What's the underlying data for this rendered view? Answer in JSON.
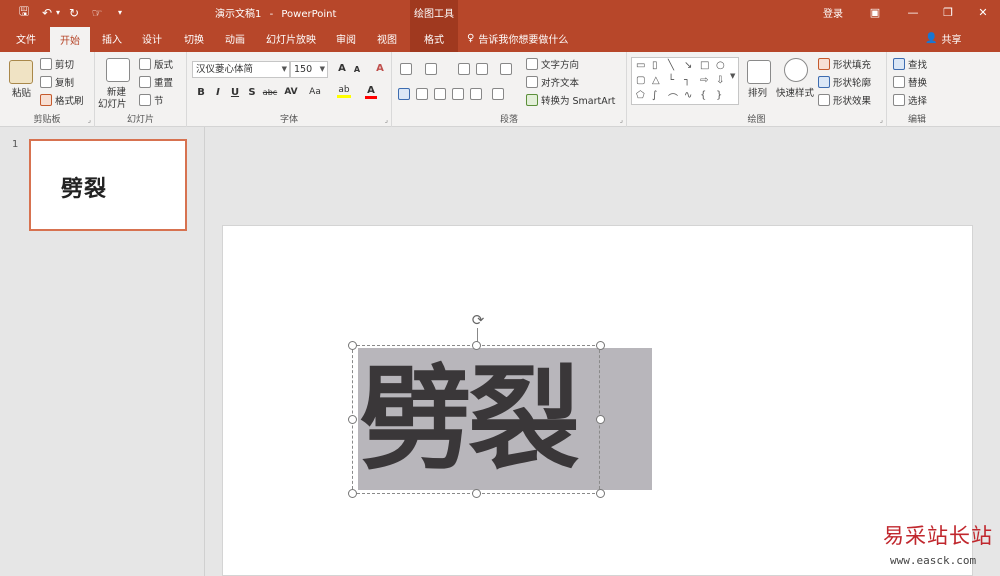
{
  "titlebar": {
    "document_name": "演示文稿1",
    "separator": "-",
    "app_name": "PowerPoint",
    "context_tools": "绘图工具",
    "login": "登录",
    "quick_access": {
      "save": "🖫",
      "undo": "↶",
      "undo_arrow": "▾",
      "redo": "↻",
      "touch": "☞",
      "customize": "▾"
    },
    "window": {
      "ribbon_options": "▣",
      "minimize": "—",
      "restore": "❐",
      "close": "✕"
    }
  },
  "tabs": [
    {
      "label": "文件"
    },
    {
      "label": "开始"
    },
    {
      "label": "插入"
    },
    {
      "label": "设计"
    },
    {
      "label": "切换"
    },
    {
      "label": "动画"
    },
    {
      "label": "幻灯片放映"
    },
    {
      "label": "审阅"
    },
    {
      "label": "视图"
    },
    {
      "label": "格式"
    }
  ],
  "tell_me": {
    "icon": "♀",
    "text": "告诉我你想要做什么"
  },
  "share": {
    "icon": "👤",
    "text": "共享"
  },
  "ribbon": {
    "clipboard": {
      "paste": "粘贴",
      "cut": "剪切",
      "copy": "复制",
      "format_painter": "格式刷",
      "label": "剪贴板"
    },
    "slides": {
      "new_slide_1": "新建",
      "new_slide_2": "幻灯片",
      "layout": "版式",
      "reset": "重置",
      "section": "节",
      "label": "幻灯片"
    },
    "font": {
      "family": "汉仪菱心体简",
      "size": "150",
      "grow": "A",
      "shrink": "A",
      "clear": "A",
      "bold": "B",
      "italic": "I",
      "underline": "U",
      "shadow": "S",
      "strike": "abc",
      "spacing": "AV",
      "case": "Aa",
      "highlight": "ab",
      "color": "A",
      "label": "字体"
    },
    "paragraph": {
      "label": "段落",
      "text_direction": "文字方向",
      "align_text": "对齐文本",
      "smartart": "转换为 SmartArt"
    },
    "drawing": {
      "arrange": "排列",
      "quick_styles": "快速样式",
      "shape_fill": "形状填充",
      "shape_outline": "形状轮廓",
      "shape_effects": "形状效果",
      "label": "绘图"
    },
    "editing": {
      "find": "查找",
      "replace": "替换",
      "select": "选择",
      "label": "编辑"
    },
    "colors": {
      "accent": "#b7472a",
      "highlight": "#ffff00",
      "font_color": "#ff0000"
    }
  },
  "thumbnails": [
    {
      "number": "1",
      "text": "劈裂"
    }
  ],
  "slide": {
    "text": "劈裂"
  },
  "watermark": {
    "cn": "易采站长站",
    "url": "www.easck.com"
  }
}
